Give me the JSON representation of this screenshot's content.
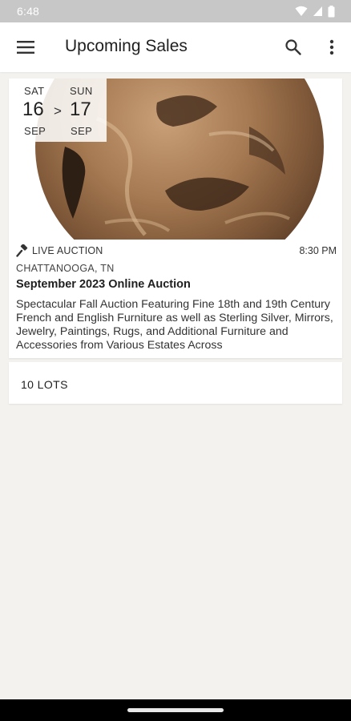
{
  "status_bar": {
    "time": "6:48",
    "icons": [
      "wifi-icon",
      "signal-icon",
      "battery-icon"
    ]
  },
  "app_bar": {
    "title": "Upcoming Sales",
    "menu_icon": "hamburger-menu-icon",
    "search_icon": "search-icon",
    "overflow_icon": "more-vert-icon"
  },
  "sale": {
    "start": {
      "dow": "SAT",
      "day": "16",
      "month": "SEP"
    },
    "end": {
      "dow": "SUN",
      "day": "17",
      "month": "SEP"
    },
    "date_separator": ">",
    "type_icon": "gavel-icon",
    "type": "LIVE AUCTION",
    "time": "8:30 PM",
    "location": "CHATTANOOGA, TN",
    "title": "September 2023 Online Auction",
    "description": "Spectacular Fall Auction Featuring Fine 18th and 19th Century French and English Furniture as well as Sterling Silver, Mirrors, Jewelry, Paintings, Rugs, and Additional Furniture and Accessories from Various Estates Across",
    "lots_label": "10 LOTS"
  },
  "colors": {
    "background": "#f3f2ef",
    "card": "#ffffff",
    "status_bar": "#c7c7c7",
    "text": "#1f1f1f"
  }
}
